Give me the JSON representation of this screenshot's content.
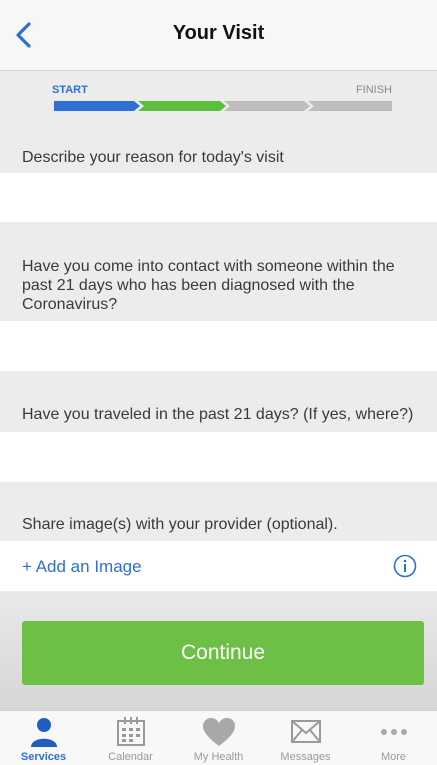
{
  "header": {
    "title": "Your Visit"
  },
  "progress": {
    "start_label": "START",
    "finish_label": "FINISH",
    "steps_total": 4,
    "steps_completed": 2,
    "colors": {
      "step1": "#2f6fd2",
      "step2": "#5cbf3c",
      "pending": "#bdbdbd"
    }
  },
  "questions": [
    {
      "text": "Describe your reason for today's visit",
      "answer_value": ""
    },
    {
      "text": "Have you come into contact with someone within the past 21 days who has been diagnosed with the Coronavirus?",
      "answer_value": ""
    },
    {
      "text": "Have you traveled in the past 21 days?  (If yes, where?)",
      "answer_value": ""
    }
  ],
  "share_images": {
    "prompt": "Share image(s) with your provider (optional).",
    "add_label": "+ Add an Image",
    "info_icon": "info-icon"
  },
  "continue_label": "Continue",
  "colors": {
    "accent": "#2f6fd2",
    "continue_bg": "#6dc045"
  },
  "tabs": [
    {
      "label": "Services",
      "icon": "person-icon",
      "active": true
    },
    {
      "label": "Calendar",
      "icon": "calendar-icon",
      "active": false
    },
    {
      "label": "My Health",
      "icon": "heart-icon",
      "active": false
    },
    {
      "label": "Messages",
      "icon": "envelope-icon",
      "active": false
    },
    {
      "label": "More",
      "icon": "more-dots-icon",
      "active": false
    }
  ]
}
